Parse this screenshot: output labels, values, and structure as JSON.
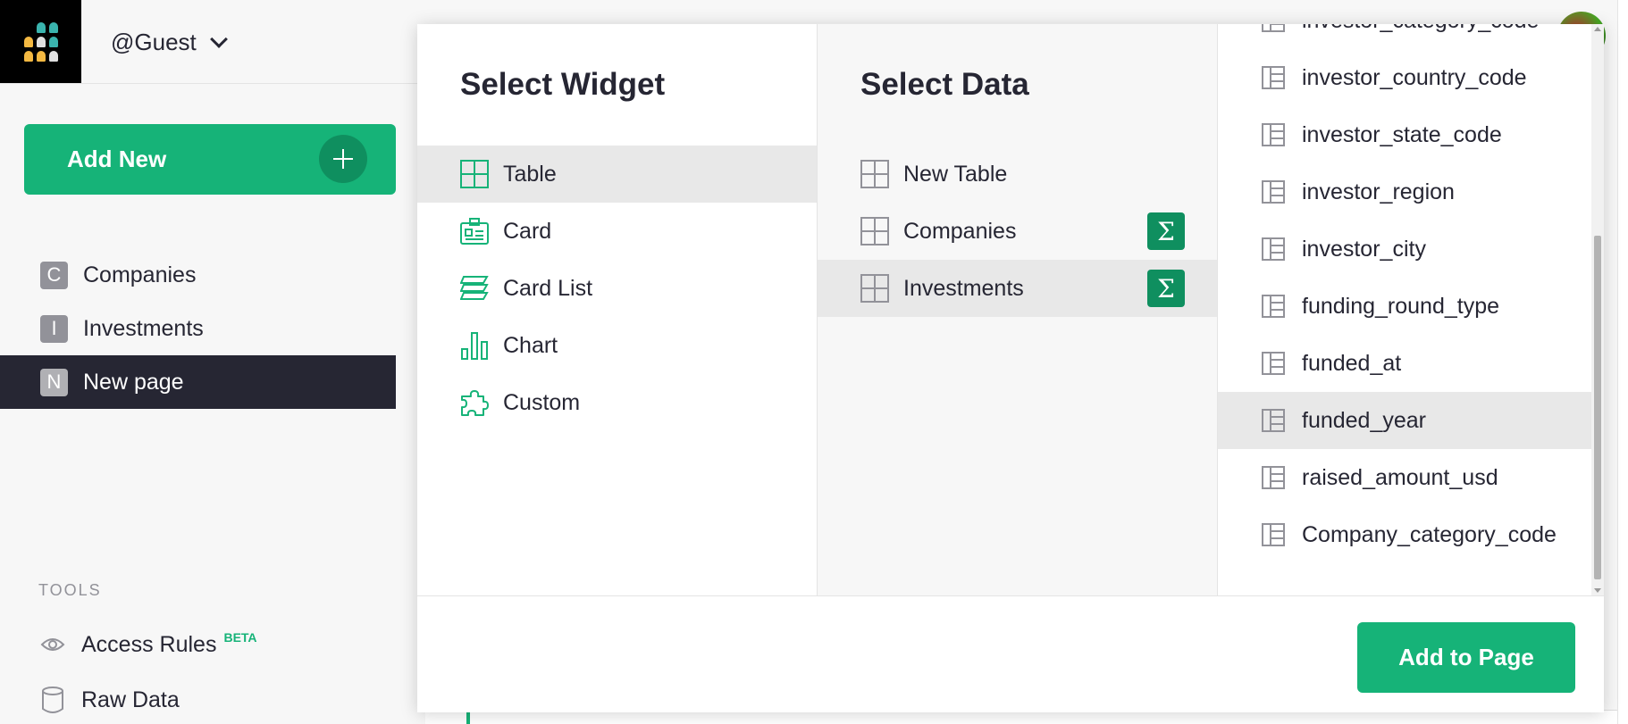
{
  "header": {
    "org_label": "@Guest"
  },
  "sidebar": {
    "add_new_label": "Add New",
    "pages": [
      {
        "initial": "C",
        "label": "Companies"
      },
      {
        "initial": "I",
        "label": "Investments"
      },
      {
        "initial": "N",
        "label": "New page"
      }
    ],
    "tools_label": "TOOLS",
    "tools": [
      {
        "label": "Access Rules",
        "badge": "BETA"
      },
      {
        "label": "Raw Data"
      }
    ]
  },
  "modal": {
    "widget_title": "Select Widget",
    "widgets": [
      {
        "label": "Table",
        "icon": "table-icon"
      },
      {
        "label": "Card",
        "icon": "card-icon"
      },
      {
        "label": "Card List",
        "icon": "card-list-icon"
      },
      {
        "label": "Chart",
        "icon": "chart-icon"
      },
      {
        "label": "Custom",
        "icon": "custom-icon"
      }
    ],
    "selected_widget": "Table",
    "data_title": "Select Data",
    "data_sources": [
      {
        "label": "New Table",
        "icon": "table-icon"
      },
      {
        "label": "Companies",
        "icon": "table-icon",
        "summary": "Σ"
      },
      {
        "label": "Investments",
        "icon": "table-icon",
        "summary": "Σ"
      }
    ],
    "selected_data": "Investments",
    "fields": [
      "investor_category_code",
      "investor_country_code",
      "investor_state_code",
      "investor_region",
      "investor_city",
      "funding_round_type",
      "funded_at",
      "funded_year",
      "raised_amount_usd",
      "Company_category_code"
    ],
    "selected_field": "funded_year",
    "add_to_page_label": "Add to Page"
  },
  "colors": {
    "accent": "#16b378",
    "accent_dark": "#0f8f5f",
    "sidebar_active": "#262633"
  }
}
